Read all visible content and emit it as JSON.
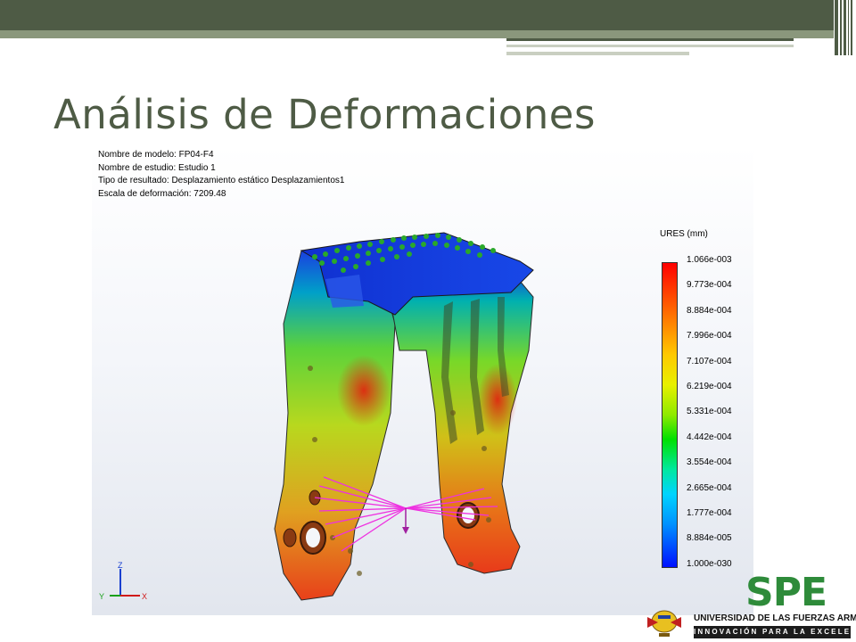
{
  "slide": {
    "title": "Análisis de Deformaciones"
  },
  "study_info": {
    "model_name": "Nombre de modelo: FP04-F4",
    "study_name": "Nombre de estudio: Estudio 1",
    "result_type": "Tipo de resultado: Desplazamiento estático Desplazamientos1",
    "deformation_scale": "Escala de deformación: 7209.48"
  },
  "legend": {
    "title": "URES (mm)",
    "values": [
      "1.066e-003",
      "9.773e-004",
      "8.884e-004",
      "7.996e-004",
      "7.107e-004",
      "6.219e-004",
      "5.331e-004",
      "4.442e-004",
      "3.554e-004",
      "2.665e-004",
      "1.777e-004",
      "8.884e-005",
      "1.000e-030"
    ]
  },
  "axes": {
    "z": "Z",
    "y": "Y",
    "x": "X"
  },
  "branding": {
    "logo_text": "SPE",
    "university": "UNIVERSIDAD DE LAS FUERZAS ARMADAS",
    "motto": "INNOVACIÓN PARA LA EXCELENCIA"
  },
  "colors": {
    "theme_dark": "#4e5b45",
    "theme_light": "#8a977c",
    "logo_green": "#2e8b3a"
  }
}
